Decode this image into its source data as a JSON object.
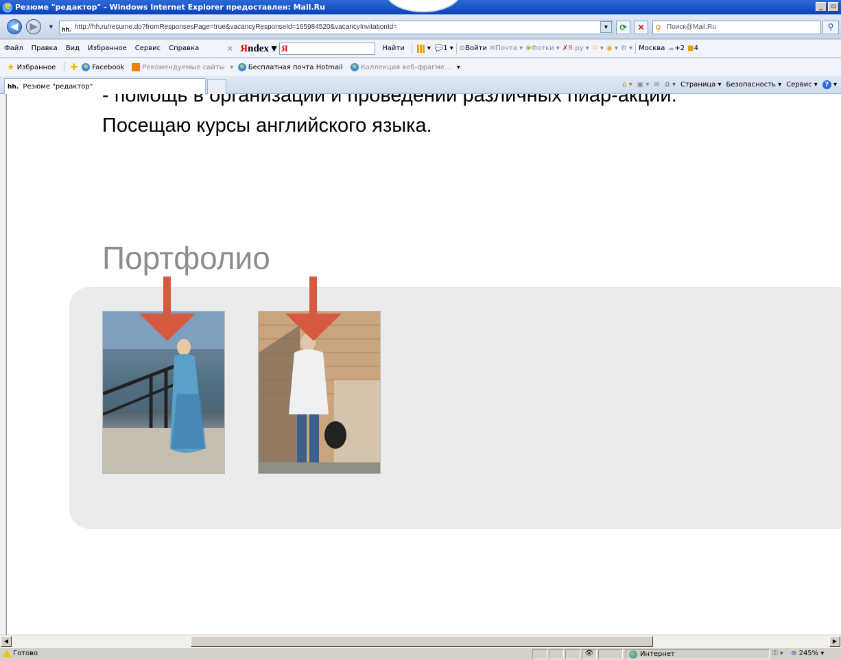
{
  "window": {
    "title": "Резюме \"редактор\" - Windows Internet Explorer предоставлен: Mail.Ru",
    "minimize": "_",
    "restore": "▫"
  },
  "address_bar": {
    "favicon_label": "hh.",
    "url": "http://hh.ru/resume.do?fromResponsesPage=true&vacancyResponseId=165984520&vacancyInvitationId=",
    "search_placeholder": "Поиск@Mail.Ru"
  },
  "menu": {
    "items": [
      "Файл",
      "Правка",
      "Вид",
      "Избранное",
      "Сервис",
      "Справка"
    ]
  },
  "yandex_bar": {
    "logo_y": "Я",
    "logo_rest": "ndex",
    "find_label": "Найти",
    "bubble_count": "1",
    "login_label": "Войти",
    "mail_label": "Почта",
    "photos_label": "Фотки",
    "yaru_label": "Я.ру",
    "city": "Москва",
    "temperature": "+2",
    "counter": "4"
  },
  "favorites_bar": {
    "favorites_label": "Избранное",
    "items": [
      {
        "label": "Facebook",
        "dimmed": false
      },
      {
        "label": "Рекомендуемые сайты",
        "dimmed": true
      },
      {
        "label": "Бесплатная почта Hotmail",
        "dimmed": false
      },
      {
        "label": "Коллекция веб-фрагме...",
        "dimmed": true
      }
    ]
  },
  "tabs": {
    "active_label": "Резюме \"редактор\"",
    "favicon_label": "hh."
  },
  "command_bar": {
    "page_label": "Страница",
    "safety_label": "Безопасность",
    "tools_label": "Сервис"
  },
  "page": {
    "cut_line": "- помощь в организации и проведении различных пиар-акций.",
    "body_line": "Посещаю курсы английского языка.",
    "portfolio_title": "Портфолио",
    "photos": [
      {
        "name": "portfolio-photo-1",
        "subject": "woman by river railing"
      },
      {
        "name": "portfolio-photo-2",
        "subject": "person by brick wall"
      }
    ],
    "arrow_color": "#d55a40"
  },
  "status_bar": {
    "status_text": "Готово",
    "zone_label": "Интернет",
    "zoom_label": "245%"
  }
}
